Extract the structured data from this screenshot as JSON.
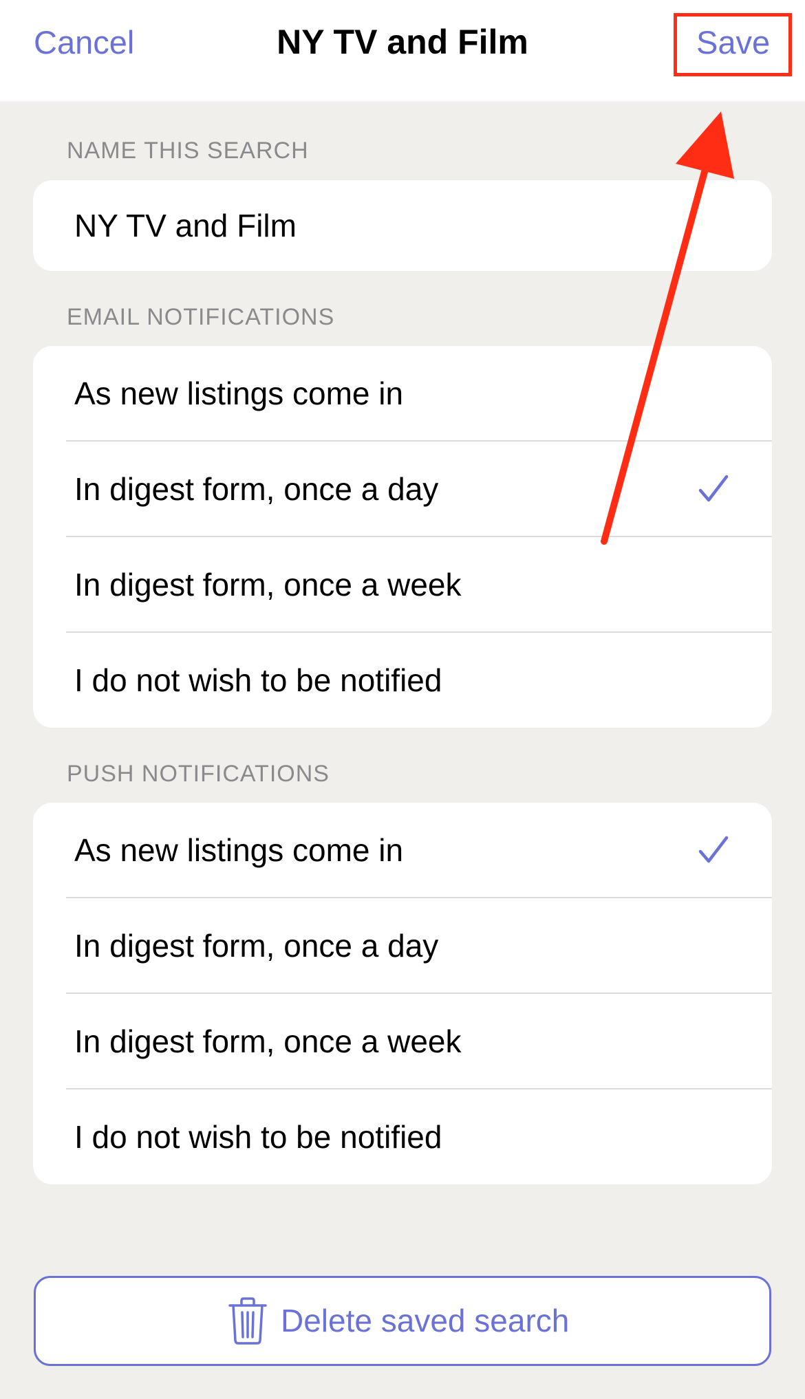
{
  "navbar": {
    "cancel_label": "Cancel",
    "title": "NY TV and Film",
    "save_label": "Save"
  },
  "name_section": {
    "header": "NAME THIS SEARCH",
    "value": "NY TV and Film"
  },
  "email_section": {
    "header": "EMAIL NOTIFICATIONS",
    "options": [
      {
        "label": "As new listings come in",
        "selected": false
      },
      {
        "label": "In digest form, once a day",
        "selected": true
      },
      {
        "label": "In digest form, once a week",
        "selected": false
      },
      {
        "label": "I do not wish to be notified",
        "selected": false
      }
    ]
  },
  "push_section": {
    "header": "PUSH NOTIFICATIONS",
    "options": [
      {
        "label": "As new listings come in",
        "selected": true
      },
      {
        "label": "In digest form, once a day",
        "selected": false
      },
      {
        "label": "In digest form, once a week",
        "selected": false
      },
      {
        "label": "I do not wish to be notified",
        "selected": false
      }
    ]
  },
  "delete_button": {
    "label": "Delete saved search",
    "icon": "trash-icon"
  },
  "colors": {
    "accent": "#6a72d8",
    "annotation": "#ff2d14",
    "background": "#f0efeb"
  }
}
